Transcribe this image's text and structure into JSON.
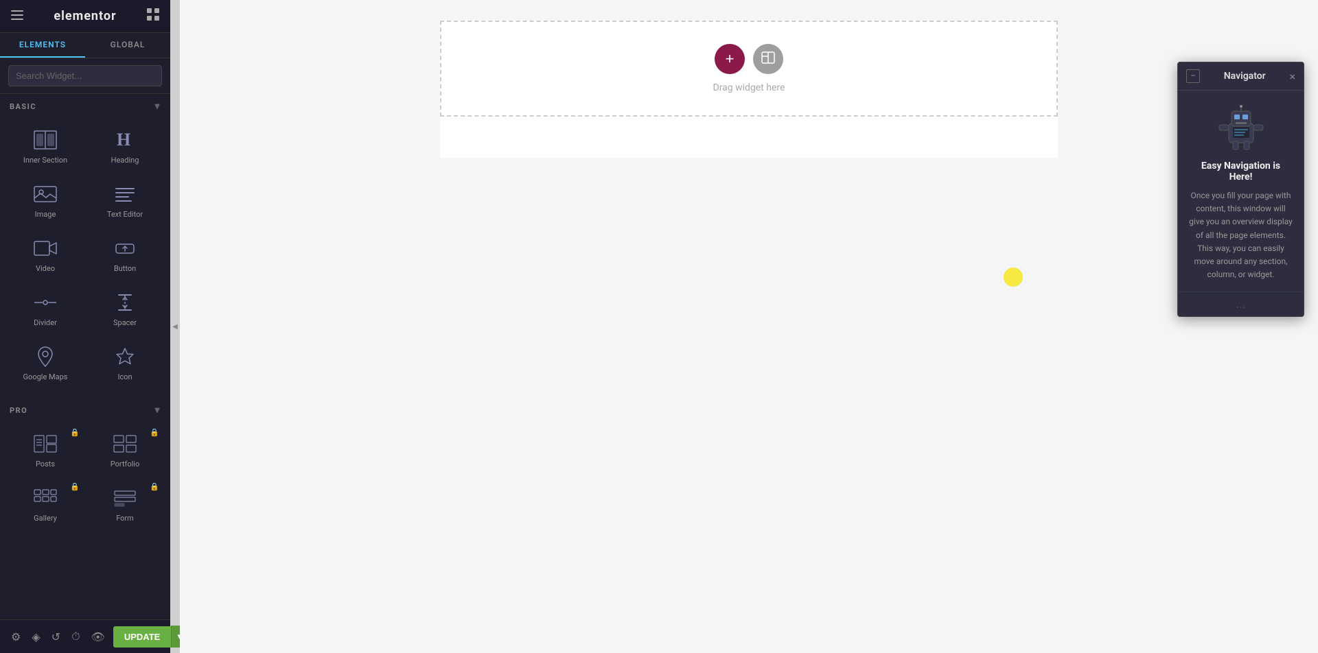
{
  "app": {
    "title": "elementor",
    "header_menu_icon": "≡",
    "header_grid_icon": "⊞"
  },
  "sidebar": {
    "tabs": [
      {
        "id": "elements",
        "label": "ELEMENTS",
        "active": true
      },
      {
        "id": "global",
        "label": "GLOBAL",
        "active": false
      }
    ],
    "search_placeholder": "Search Widget...",
    "sections": [
      {
        "id": "basic",
        "label": "BASIC",
        "expanded": true,
        "widgets": [
          {
            "id": "inner-section",
            "label": "Inner Section",
            "icon_type": "inner-section"
          },
          {
            "id": "heading",
            "label": "Heading",
            "icon_type": "heading"
          },
          {
            "id": "image",
            "label": "Image",
            "icon_type": "image"
          },
          {
            "id": "text-editor",
            "label": "Text Editor",
            "icon_type": "text-editor"
          },
          {
            "id": "video",
            "label": "Video",
            "icon_type": "video"
          },
          {
            "id": "button",
            "label": "Button",
            "icon_type": "button"
          },
          {
            "id": "divider",
            "label": "Divider",
            "icon_type": "divider"
          },
          {
            "id": "spacer",
            "label": "Spacer",
            "icon_type": "spacer"
          },
          {
            "id": "google-maps",
            "label": "Google Maps",
            "icon_type": "google-maps"
          },
          {
            "id": "icon",
            "label": "Icon",
            "icon_type": "icon-star"
          }
        ]
      },
      {
        "id": "pro",
        "label": "PRO",
        "expanded": true,
        "widgets": [
          {
            "id": "posts",
            "label": "Posts",
            "icon_type": "posts",
            "locked": true
          },
          {
            "id": "portfolio",
            "label": "Portfolio",
            "icon_type": "portfolio",
            "locked": true
          },
          {
            "id": "gallery",
            "label": "Gallery",
            "icon_type": "gallery",
            "locked": true
          },
          {
            "id": "form",
            "label": "Form",
            "icon_type": "form",
            "locked": true
          }
        ]
      }
    ],
    "bottom_icons": [
      "settings",
      "layers",
      "undo",
      "history",
      "preview"
    ],
    "update_button": "UPDATE"
  },
  "canvas": {
    "drop_zone_text": "Drag widget here",
    "add_button_label": "+",
    "template_button_label": "◧"
  },
  "navigator": {
    "title": "Navigator",
    "heading": "Easy Navigation is Here!",
    "description": "Once you fill your page with content, this window will give you an overview display of all the page elements. This way, you can easily move around any section, column, or widget.",
    "footer_dots": "...",
    "close_label": "×",
    "minimize_label": "−"
  }
}
